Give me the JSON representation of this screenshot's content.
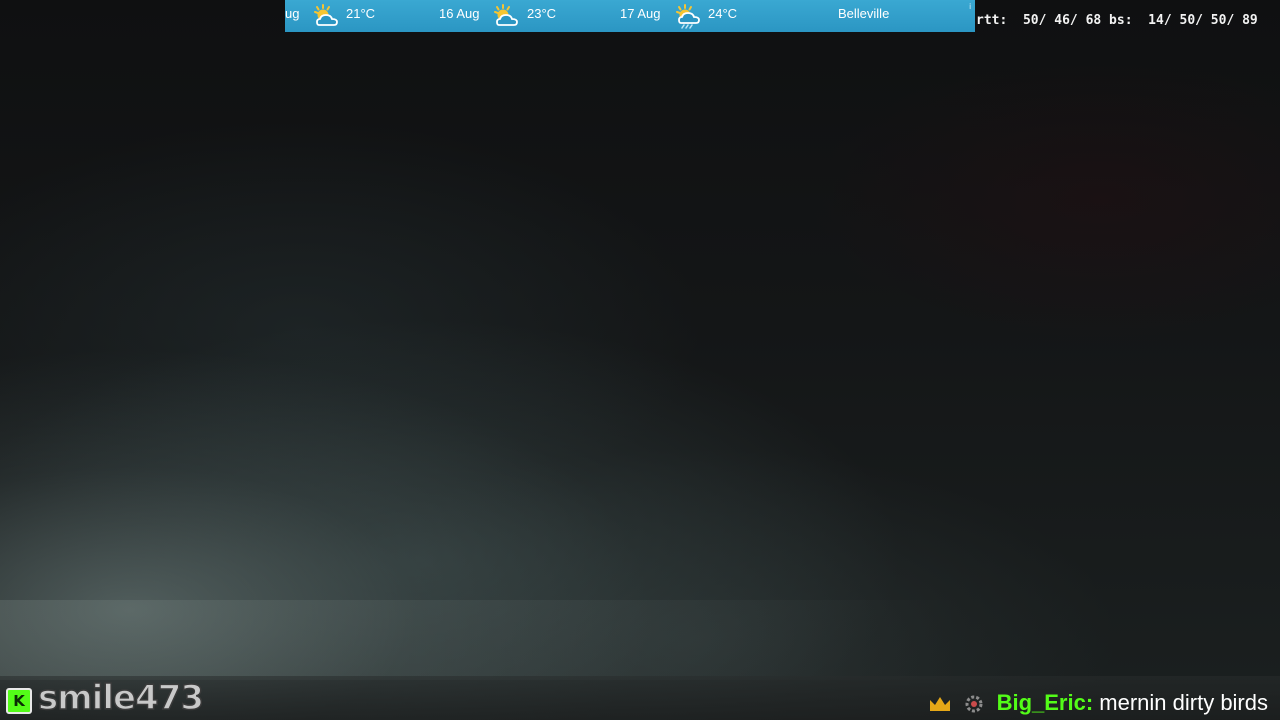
{
  "weather": {
    "items": [
      {
        "date": "ug",
        "icon": "sun-cloud-icon",
        "temp": "21°C"
      },
      {
        "date": "16 Aug",
        "icon": "sun-cloud-icon",
        "temp": "23°C"
      },
      {
        "date": "17 Aug",
        "icon": "sun-cloud-rain-icon",
        "temp": "24°C"
      }
    ],
    "location": "Belleville",
    "info_glyph": "i",
    "colors": {
      "bar": "#2b96c3",
      "text": "#ffffff"
    }
  },
  "stats": {
    "text": "rtt:  50/ 46/ 68 bs:  14/ 50/ 50/ 89"
  },
  "stream": {
    "channel": "smile473",
    "platform_icon": "kick-logo-icon",
    "platform_glyph": "K",
    "accent": "#53fc18"
  },
  "chat": {
    "badges": [
      "crown-icon",
      "gear-badge-icon"
    ],
    "user": "Big_Eric:",
    "message": "mernin dirty birds"
  }
}
